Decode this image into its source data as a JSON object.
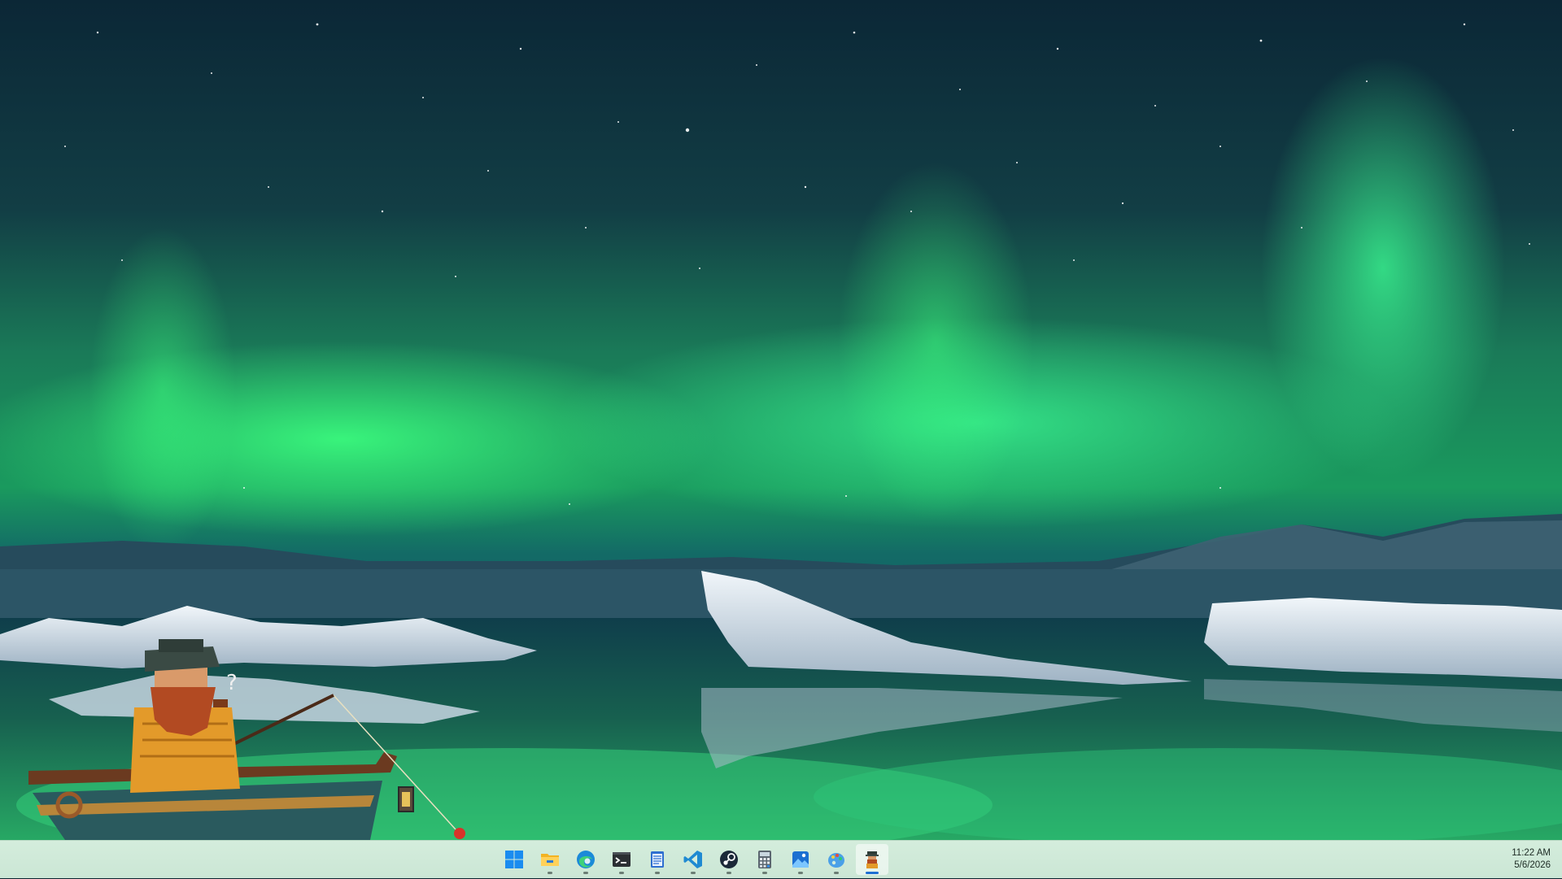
{
  "taskbar": {
    "apps": [
      {
        "id": "start",
        "icon": "windows-start-icon",
        "running": false,
        "active": false
      },
      {
        "id": "file-explorer",
        "icon": "folder-icon",
        "running": true,
        "active": false
      },
      {
        "id": "edge",
        "icon": "edge-browser-icon",
        "running": true,
        "active": false
      },
      {
        "id": "terminal",
        "icon": "terminal-icon",
        "running": true,
        "active": false
      },
      {
        "id": "notepad",
        "icon": "notepad-icon",
        "running": true,
        "active": false
      },
      {
        "id": "vscode",
        "icon": "vscode-icon",
        "running": true,
        "active": false
      },
      {
        "id": "steam",
        "icon": "steam-icon",
        "running": true,
        "active": false
      },
      {
        "id": "calculator",
        "icon": "calculator-icon",
        "running": true,
        "active": false
      },
      {
        "id": "photos",
        "icon": "photos-icon",
        "running": true,
        "active": false
      },
      {
        "id": "paint",
        "icon": "paint-icon",
        "running": true,
        "active": false
      },
      {
        "id": "fisherman-app",
        "icon": "fisherman-pet-icon",
        "running": true,
        "active": true
      }
    ],
    "clock": {
      "time": "11:22 AM",
      "date": "5/6/2026"
    }
  },
  "colors": {
    "aurora": "#27e07a",
    "sky_top": "#0c2b3b",
    "water": "#1e8a60",
    "taskbar": "#d4eddc"
  }
}
